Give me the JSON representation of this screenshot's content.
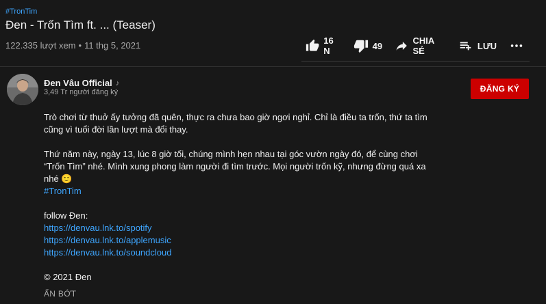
{
  "video": {
    "hashtag": "#TronTim",
    "title": "Đen - Trốn Tìm ft. ... (Teaser)",
    "views": "122.335 lượt xem",
    "separator": "•",
    "date": "11 thg 5, 2021"
  },
  "actions": {
    "like_count": "16 N",
    "dislike_count": "49",
    "share_label": "CHIA SẺ",
    "save_label": "LƯU",
    "icons": [
      "thumb-up-icon",
      "thumb-down-icon",
      "share-icon",
      "playlist-add-icon",
      "more-icon"
    ]
  },
  "channel": {
    "name": "Đen Vâu Official",
    "badge": "♪",
    "subscribers": "3,49 Tr người đăng ký",
    "subscribe_label": "ĐĂNG KÝ"
  },
  "description": {
    "para1": "Trò chơi từ thuở ấy tưởng đã quên, thực ra chưa bao giờ ngơi nghỉ. Chỉ là điều ta trốn, thứ ta tìm cũng vì tuổi đời lần lượt mà đổi thay.",
    "para2": "Thứ năm này, ngày 13, lúc 8 giờ tối, chúng mình hẹn nhau tại góc vườn ngày đó, để cùng chơi “Trốn Tìm” nhé. Mình xung phong làm người đi tìm trước. Mọi người trốn kỹ, nhưng đừng quá xa nhé 🙂",
    "hashtag": "#TronTim",
    "follow_label": "follow Đen:",
    "links": [
      "https://denvau.lnk.to/spotify",
      "https://denvau.lnk.to/applemusic",
      "https://denvau.lnk.to/soundcloud"
    ],
    "copyright": "© 2021 Đen"
  },
  "show_less_label": "ẨN BỚT",
  "colors": {
    "background": "#181818",
    "link": "#3ea6ff",
    "subscribe": "#cc0000",
    "secondary_text": "#aaaaaa"
  }
}
